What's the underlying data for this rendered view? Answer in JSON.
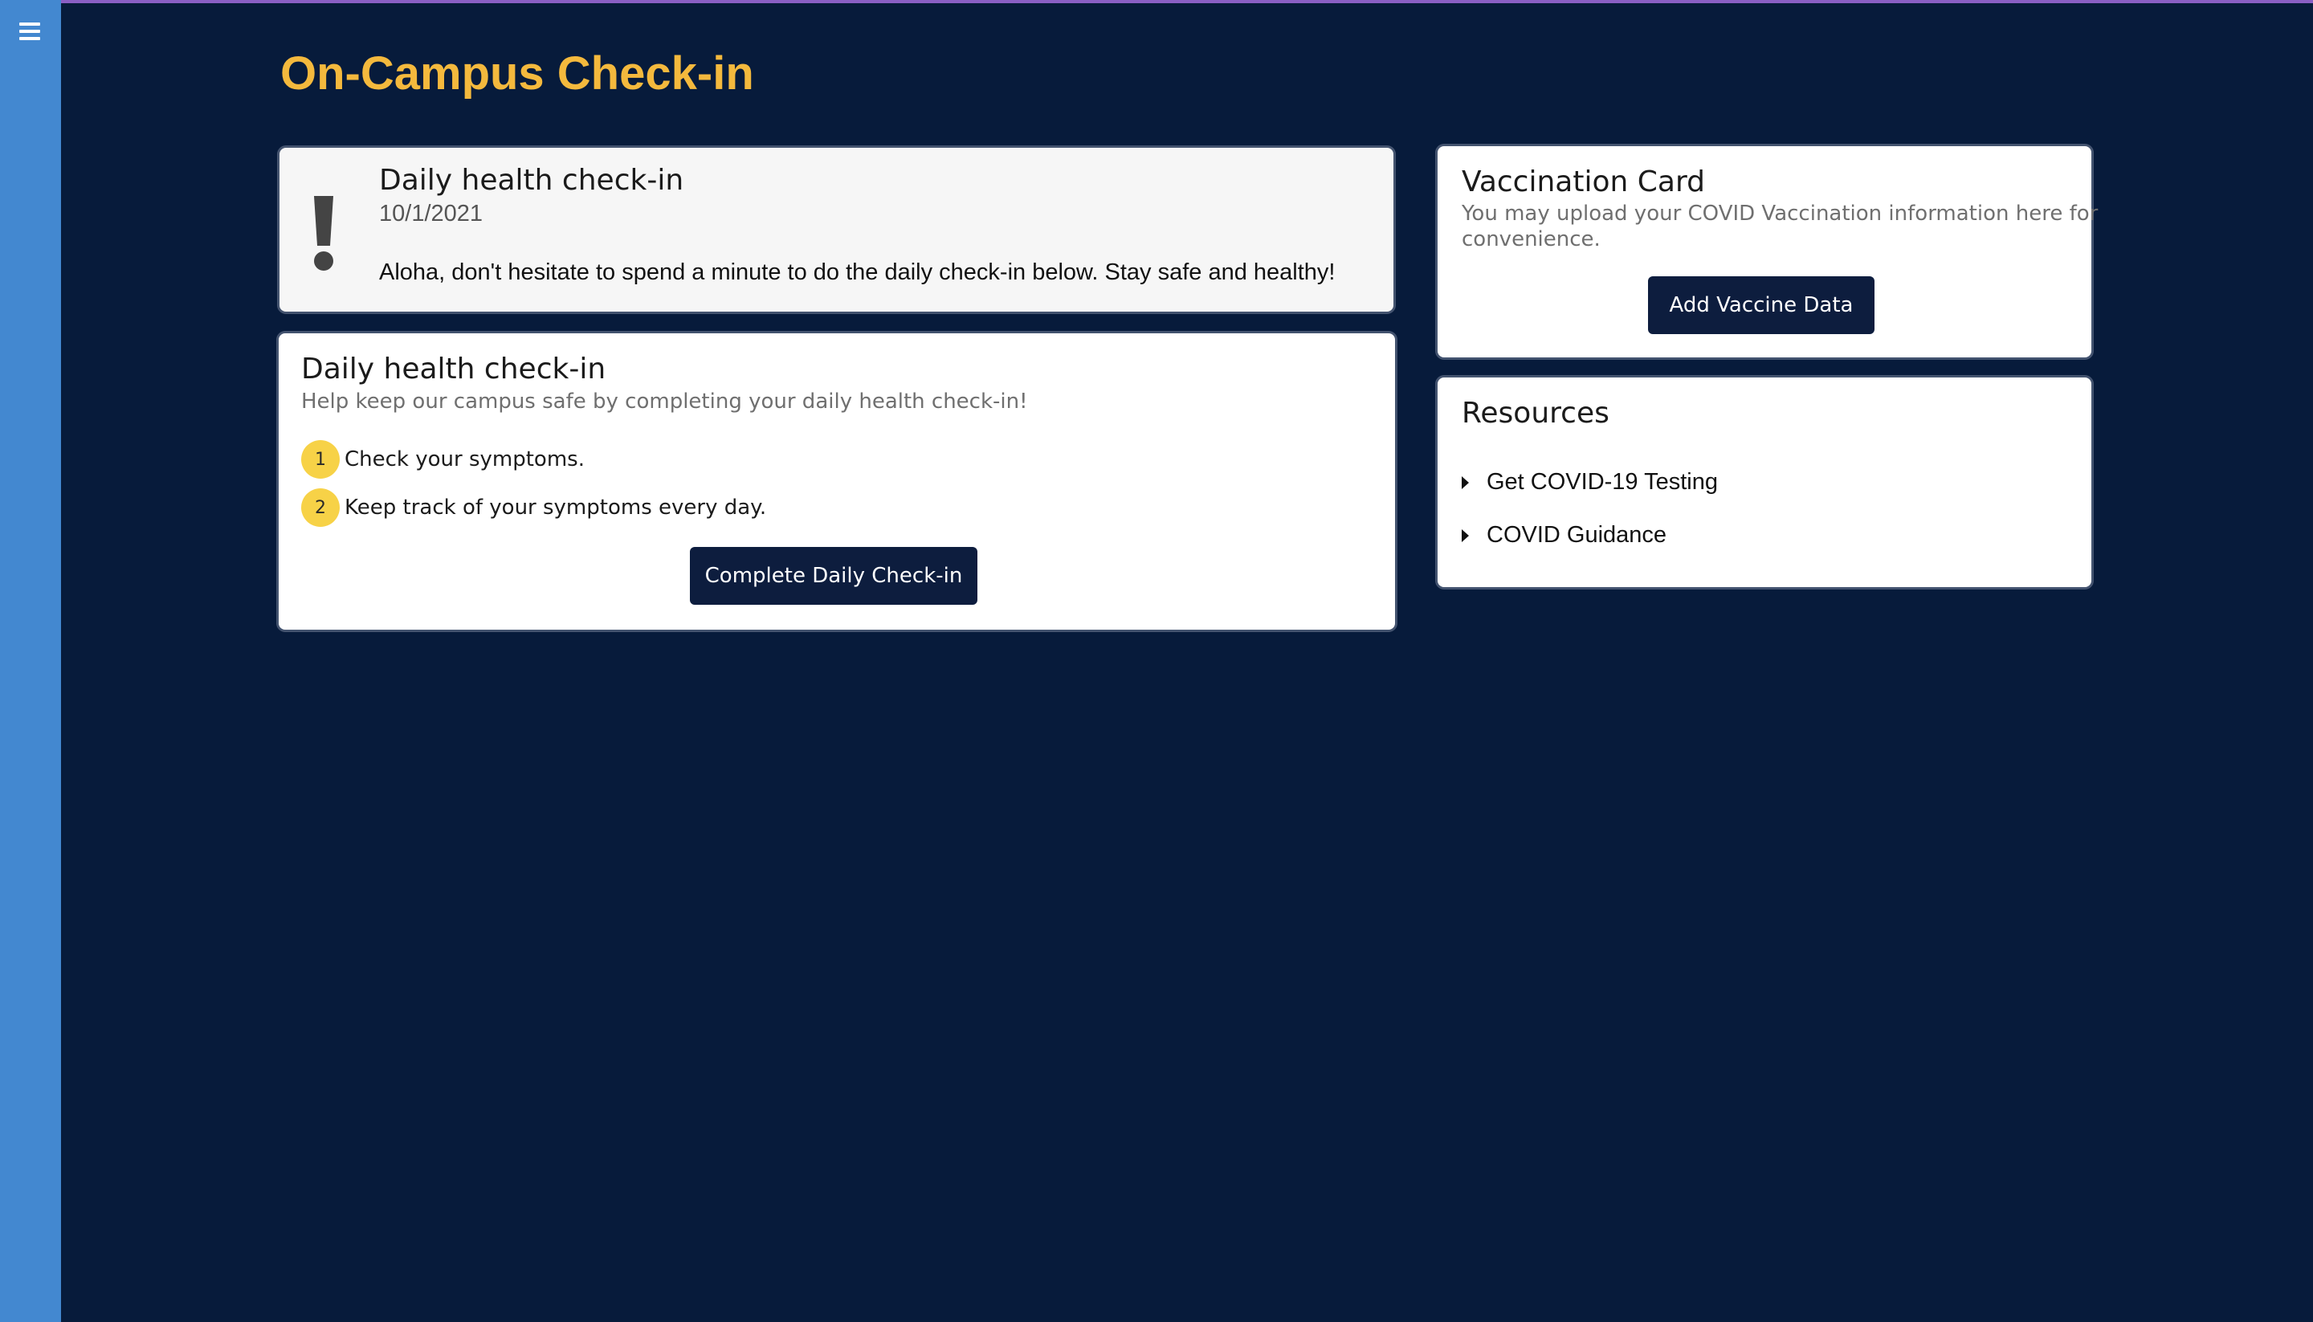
{
  "page": {
    "title": "On-Campus Check-in"
  },
  "sidebar": {
    "menu_icon": "hamburger-menu-icon"
  },
  "alert": {
    "icon": "exclamation-icon",
    "title": "Daily health check-in",
    "date": "10/1/2021",
    "message": "Aloha, don't hesitate to spend a minute to do the daily check-in below. Stay safe and healthy!"
  },
  "checkin": {
    "title": "Daily health check-in",
    "subtitle": "Help keep our campus safe by completing your daily health check-in!",
    "steps": [
      {
        "number": "1",
        "text": "Check your symptoms."
      },
      {
        "number": "2",
        "text": "Keep track of your symptoms every day."
      }
    ],
    "button_label": "Complete Daily Check-in"
  },
  "vaccination": {
    "title": "Vaccination Card",
    "description_line1": "You may upload your COVID Vaccination information here for",
    "description_line2": "convenience.",
    "button_label": "Add Vaccine Data"
  },
  "resources": {
    "title": "Resources",
    "items": [
      {
        "label": "Get COVID-19 Testing",
        "icon": "caret-right-icon"
      },
      {
        "label": "COVID Guidance",
        "icon": "caret-right-icon"
      }
    ]
  },
  "colors": {
    "background": "#071b3b",
    "sidebar": "#4388d0",
    "title_accent": "#f4b93d",
    "step_badge": "#f7d247",
    "button": "#0d1d3e"
  }
}
